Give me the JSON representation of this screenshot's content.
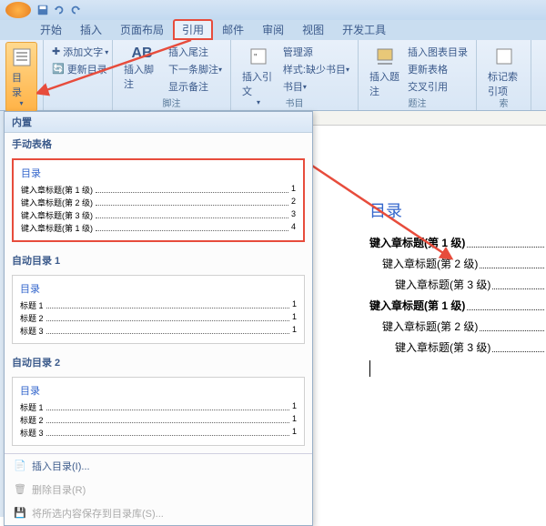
{
  "tabs": [
    "开始",
    "插入",
    "页面布局",
    "引用",
    "邮件",
    "审阅",
    "视图",
    "开发工具"
  ],
  "active_tab_index": 3,
  "toc_button": {
    "label": "目录"
  },
  "group1": {
    "add_text": "添加文字",
    "update_toc": "更新目录"
  },
  "footnote": {
    "insert": "插入脚注",
    "AB": "AB",
    "endnote": "插入尾注",
    "next": "下一条脚注",
    "show": "显示备注"
  },
  "citation": {
    "insert_cite": "插入引文",
    "manage": "管理源",
    "style": "样式:",
    "missing": "缺少书目",
    "biblio": "书目"
  },
  "caption": {
    "insert": "插入题注",
    "fig_toc": "插入图表目录",
    "update_table": "更新表格",
    "crossref": "交叉引用"
  },
  "index": {
    "mark": "标记索引项",
    "label_partial": "索"
  },
  "ribbon_group_labels": {
    "footnote": "脚注",
    "biblio": "书目",
    "caption": "题注"
  },
  "gallery": {
    "builtin": "内置",
    "manual": "手动表格",
    "manual_item": {
      "title": "目录",
      "lines": [
        {
          "text": "键入章标题(第 1 级)",
          "page": "1",
          "indent": 0
        },
        {
          "text": "键入章标题(第 2 级)",
          "page": "2",
          "indent": 1
        },
        {
          "text": "键入章标题(第 3 级)",
          "page": "3",
          "indent": 2
        },
        {
          "text": "键入章标题(第 1 级)",
          "page": "4",
          "indent": 0
        }
      ]
    },
    "auto1": "自动目录 1",
    "auto1_item": {
      "title": "目录",
      "lines": [
        {
          "text": "标题 1",
          "page": "1",
          "indent": 0
        },
        {
          "text": "标题 2",
          "page": "1",
          "indent": 1
        },
        {
          "text": "标题 3",
          "page": "1",
          "indent": 2
        }
      ]
    },
    "auto2": "自动目录 2",
    "auto2_item": {
      "title": "目录",
      "lines": [
        {
          "text": "标题 1",
          "page": "1",
          "indent": 0
        },
        {
          "text": "标题 2",
          "page": "1",
          "indent": 1
        },
        {
          "text": "标题 3",
          "page": "1",
          "indent": 2
        }
      ]
    },
    "insert_custom": "插入目录(I)...",
    "remove": "删除目录(R)",
    "save_selection": "将所选内容保存到目录库(S)..."
  },
  "doc": {
    "title": "目录",
    "entries": [
      {
        "text": "键入章标题(第 1 级)",
        "level": 1
      },
      {
        "text": "键入章标题(第 2 级)",
        "level": 2
      },
      {
        "text": "键入章标题(第 3 级)",
        "level": 3
      },
      {
        "text": "键入章标题(第 1 级)",
        "level": 1
      },
      {
        "text": "键入章标题(第 2 级)",
        "level": 2
      },
      {
        "text": "键入章标题(第 3 级)",
        "level": 3
      }
    ]
  }
}
